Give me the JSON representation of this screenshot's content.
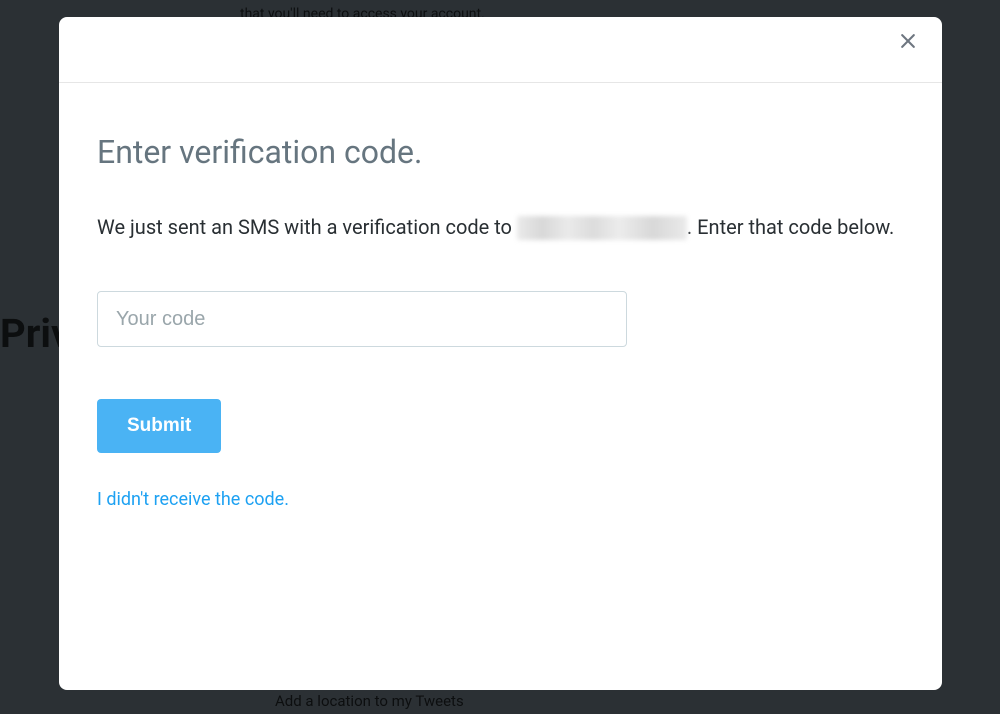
{
  "background": {
    "top_text": "that you'll need to access your account.",
    "left_label": "Priv",
    "bottom_text": "Add a location to my Tweets"
  },
  "modal": {
    "title": "Enter verification code.",
    "description_pre": "We just sent an SMS with a verification code to ",
    "description_post": ". Enter that code below.",
    "input_placeholder": "Your code",
    "input_value": "",
    "submit_label": "Submit",
    "resend_label": "I didn't receive the code.",
    "close_label": "Close"
  }
}
